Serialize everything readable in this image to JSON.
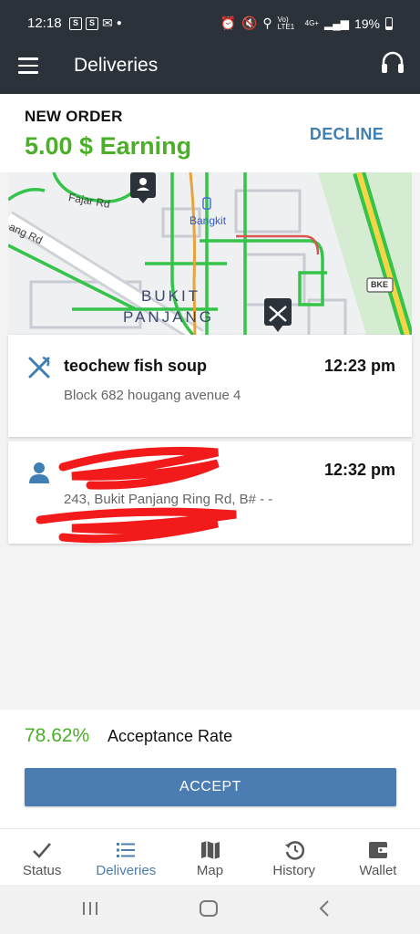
{
  "status_bar": {
    "time": "12:18",
    "network": "Vo) LTE1",
    "signal": "4G+",
    "battery": "19%"
  },
  "app_bar": {
    "title": "Deliveries"
  },
  "order": {
    "label": "NEW ORDER",
    "earning": "5.00 $ Earning",
    "decline_label": "DECLINE"
  },
  "map": {
    "labels": {
      "road1": "Fajar Rd",
      "road2": "ang Rd",
      "station": "Bangkit",
      "area_line1": "BUKIT",
      "area_line2": "PANJANG",
      "highway": "BKE"
    }
  },
  "pickup": {
    "name": "teochew fish soup",
    "time": "12:23 pm",
    "address": "Block 682 hougang avenue 4"
  },
  "dropoff": {
    "time": "12:32 pm",
    "address": "243, Bukit Panjang Ring Rd, B# - -"
  },
  "acceptance": {
    "rate": "78.62%",
    "label": "Acceptance Rate",
    "accept_label": "ACCEPT"
  },
  "tabs": [
    {
      "label": "Status",
      "icon": "check-icon"
    },
    {
      "label": "Deliveries",
      "icon": "list-icon",
      "active": true
    },
    {
      "label": "Map",
      "icon": "map-icon"
    },
    {
      "label": "History",
      "icon": "history-icon"
    },
    {
      "label": "Wallet",
      "icon": "wallet-icon"
    }
  ],
  "colors": {
    "header_bg": "#2c323a",
    "earning_green": "#4caf29",
    "accent_blue": "#4b7db2"
  }
}
